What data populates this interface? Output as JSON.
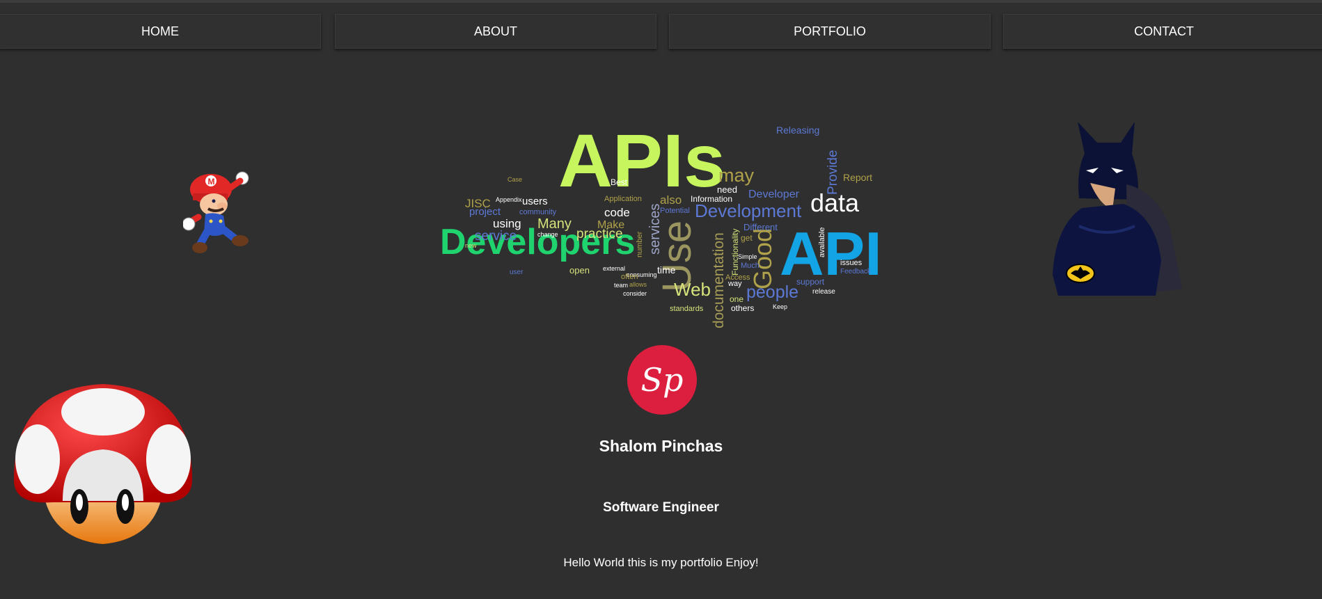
{
  "nav": {
    "items": [
      {
        "label": "HOME"
      },
      {
        "label": "ABOUT"
      },
      {
        "label": "PORTFOLIO"
      },
      {
        "label": "CONTACT"
      }
    ]
  },
  "wordcloud": {
    "words_major": [
      "APIs",
      "Developers",
      "API",
      "Use",
      "Development",
      "data",
      "Web",
      "Good",
      "documentation",
      "people",
      "may",
      "services"
    ],
    "words_minor": [
      "Releasing",
      "Provide",
      "Report",
      "Developer",
      "Many",
      "practice",
      "service",
      "using",
      "project",
      "JISC",
      "users",
      "community",
      "code",
      "Make",
      "also",
      "Potential",
      "Information",
      "need",
      "Different",
      "Functionality",
      "time",
      "open",
      "team",
      "standards",
      "one",
      "others",
      "support",
      "release",
      "issues",
      "Feedback",
      "Access",
      "Much",
      "available",
      "Best",
      "Application",
      "number",
      "Keep",
      "way",
      "Simple",
      "Appendix",
      "Case",
      "change",
      "user",
      "new",
      "consider",
      "external",
      "consuming",
      "often",
      "allows",
      "get"
    ]
  },
  "logo": {
    "text": "Sp"
  },
  "profile": {
    "name": "Shalom Pinchas",
    "role": "Software Engineer",
    "greeting": "Hello World this is my portfolio Enjoy!"
  },
  "colors": {
    "background": "#2f2f2f",
    "nav_button": "#303030",
    "logo_circle": "#dc1f3f"
  },
  "images": {
    "mario": "mario-icon",
    "batman": "batman-icon",
    "mushroom": "mushroom-icon"
  }
}
